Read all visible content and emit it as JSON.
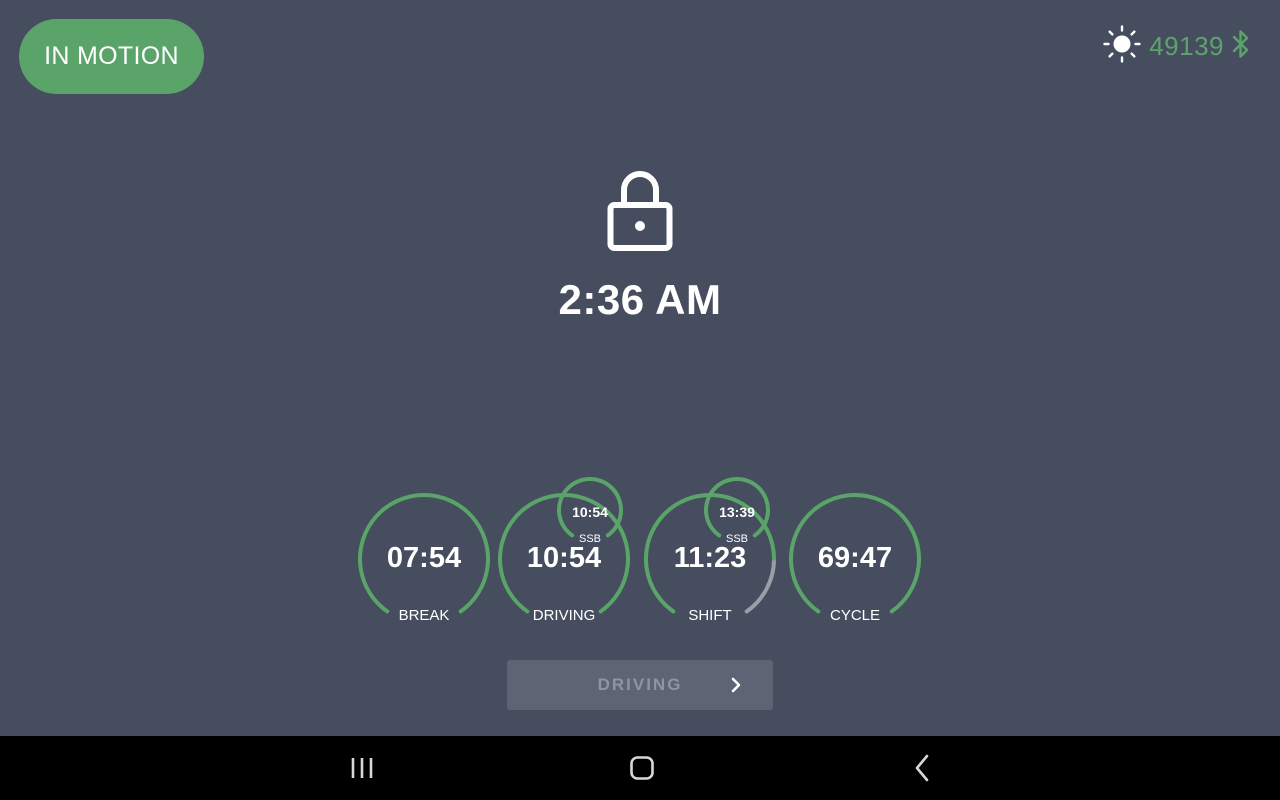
{
  "status": {
    "label": "IN MOTION",
    "color": "#5aa46a"
  },
  "header": {
    "brightness_icon": "sun-icon",
    "vehicle_id": "49139",
    "connection_icon": "bluetooth-icon"
  },
  "lock_screen": {
    "icon": "lock-icon",
    "time": "2:36 AM"
  },
  "gauges": [
    {
      "label": "BREAK",
      "value": "07:54",
      "progress": 1.0
    },
    {
      "label": "DRIVING",
      "value": "10:54",
      "progress": 1.0,
      "ssb": {
        "value": "10:54",
        "label": "SSB"
      }
    },
    {
      "label": "SHIFT",
      "value": "11:23",
      "progress": 0.81,
      "ssb": {
        "value": "13:39",
        "label": "SSB"
      }
    },
    {
      "label": "CYCLE",
      "value": "69:47",
      "progress": 1.0
    }
  ],
  "duty_status_button": {
    "label": "DRIVING",
    "icon": "chevron-right-icon"
  },
  "navbar": {
    "recents_icon": "recents-icon",
    "home_icon": "home-icon",
    "back_icon": "back-icon"
  },
  "colors": {
    "background": "#454d5e",
    "accent": "#5aa46a",
    "track": "#9a9ea6"
  }
}
